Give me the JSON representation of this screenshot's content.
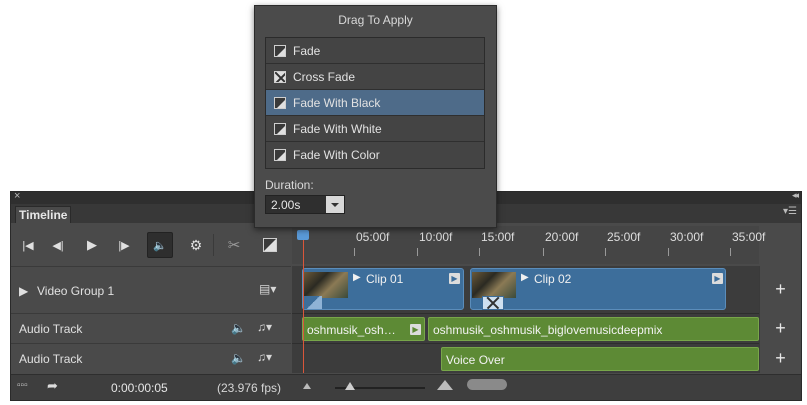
{
  "popup": {
    "title": "Drag To Apply",
    "items": [
      {
        "label": "Fade",
        "icon": "fade-icon"
      },
      {
        "label": "Cross Fade",
        "icon": "cross-fade-icon"
      },
      {
        "label": "Fade With Black",
        "icon": "fade-icon",
        "selected": true
      },
      {
        "label": "Fade With White",
        "icon": "fade-icon"
      },
      {
        "label": "Fade With Color",
        "icon": "fade-icon"
      }
    ],
    "duration_label": "Duration:",
    "duration_value": "2.00s"
  },
  "panel": {
    "close_glyph": "×",
    "collapse_glyph": "◂◂",
    "tab": "Timeline",
    "menu_glyph": "▾☰"
  },
  "transport": {
    "first_glyph": "|◀",
    "prev_glyph": "◀|",
    "play_glyph": "▶",
    "next_glyph": "|▶",
    "mute_glyph": "🔈",
    "settings_glyph": "⚙",
    "split_glyph": "✂"
  },
  "ruler": {
    "labels": [
      "05:00f",
      "10:00f",
      "15:00f",
      "20:00f",
      "25:00f",
      "30:00f",
      "35:00f"
    ]
  },
  "tracks": {
    "video_group": "Video Group 1",
    "audio1": "Audio Track",
    "audio2": "Audio Track",
    "clip1": "Clip 01",
    "clip2": "Clip 02",
    "audio_clip_a": "oshmusik_osh…",
    "audio_clip_b": "oshmusik_oshmusik_biglovemusicdeepmix",
    "voice_over": "Voice Over",
    "add_glyph": "+"
  },
  "status": {
    "timecode": "0:00:00:05",
    "fps": "(23.976 fps)"
  },
  "colors": {
    "video_clip": "#3d6e9b",
    "audio_clip": "#5d8a35",
    "playhead": "#d9563a",
    "selection": "#4e6b89"
  }
}
